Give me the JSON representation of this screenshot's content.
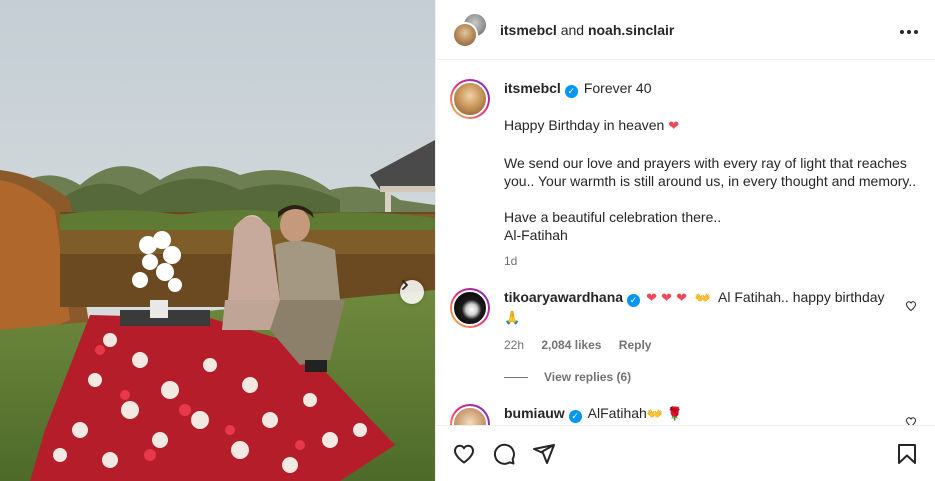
{
  "header": {
    "user1": "itsmebcl",
    "and": "and",
    "user2": "noah.sinclair",
    "more_icon": "more-horizontal-icon"
  },
  "caption": {
    "username": "itsmebcl",
    "title": "Forever 40",
    "line1": "Happy Birthday in heaven",
    "line1_emoji": "❤",
    "line2": "We send our love and prayers with every ray of light that reaches you.. Your warmth is still around us, in every thought and memory..",
    "line3a": "Have a beautiful celebration there..",
    "line3b": "Al-Fatihah",
    "time": "1d"
  },
  "comments": [
    {
      "username": "tikoaryawardhana",
      "hearts": "❤ ❤ ❤",
      "hands": "👐",
      "text": "Al Fatihah.. happy birthday",
      "pray": "🙏",
      "time": "22h",
      "likes": "2,084 likes",
      "reply": "Reply",
      "view_replies": "View replies (6)"
    },
    {
      "username": "bumiauw",
      "text": "AlFatihah",
      "hands": "👐",
      "rose": "🌹"
    }
  ],
  "colors": {
    "verified": "#0095f6",
    "heart": "#ed4956",
    "meta": "#737373",
    "ring_gradient": [
      "#f9ce34",
      "#ee2a7b",
      "#6228d7"
    ]
  },
  "icons": [
    "like-icon",
    "comment-icon",
    "share-icon",
    "save-icon",
    "next-arrow-icon",
    "verified-badge-icon"
  ]
}
